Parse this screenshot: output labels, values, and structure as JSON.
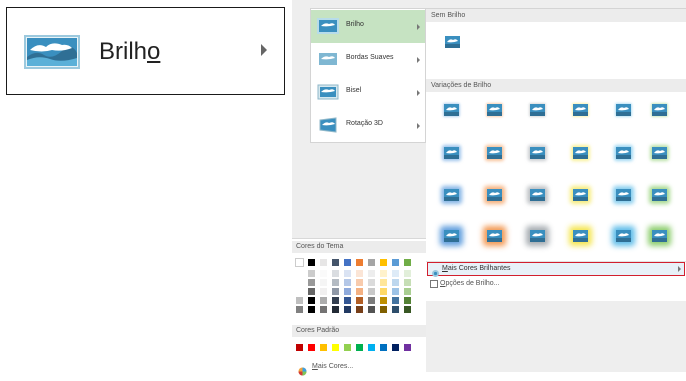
{
  "callout": {
    "label_pre": "Brilh",
    "label_underlined": "o"
  },
  "effects_menu": {
    "items": [
      {
        "label": "Brilho",
        "selected": true
      },
      {
        "label": "Bordas Suaves"
      },
      {
        "label": "Bisel"
      },
      {
        "label": "Rotação 3D"
      }
    ]
  },
  "gallery": {
    "no_glow_header": "Sem Brilho",
    "variations_header": "Variações de Brilho",
    "glow_row_colors": [
      "#4a90d9",
      "#f08a3c",
      "#9aa0a6",
      "#f2e23a",
      "#4ab4e6",
      "#7dc65a"
    ]
  },
  "glow_menu": {
    "more_label_underlined": "M",
    "more_label_rest": "ais Cores Brilhantes",
    "options_label_underlined": "O",
    "options_label_rest": "pções de Brilho..."
  },
  "palette": {
    "theme_header": "Cores do Tema",
    "theme_colors": [
      "#ffffff",
      "#000000",
      "#e7e6e6",
      "#44546a",
      "#4472c4",
      "#ed7d31",
      "#a5a5a5",
      "#ffc000",
      "#5b9bd5",
      "#70ad47"
    ],
    "standard_header": "Cores Padrão",
    "standard_colors": [
      "#c00000",
      "#ff0000",
      "#ffc000",
      "#ffff00",
      "#92d050",
      "#00b050",
      "#00b0f0",
      "#0070c0",
      "#002060",
      "#7030a0"
    ],
    "more_colors_underlined": "M",
    "more_colors_rest": "ais Cores..."
  }
}
